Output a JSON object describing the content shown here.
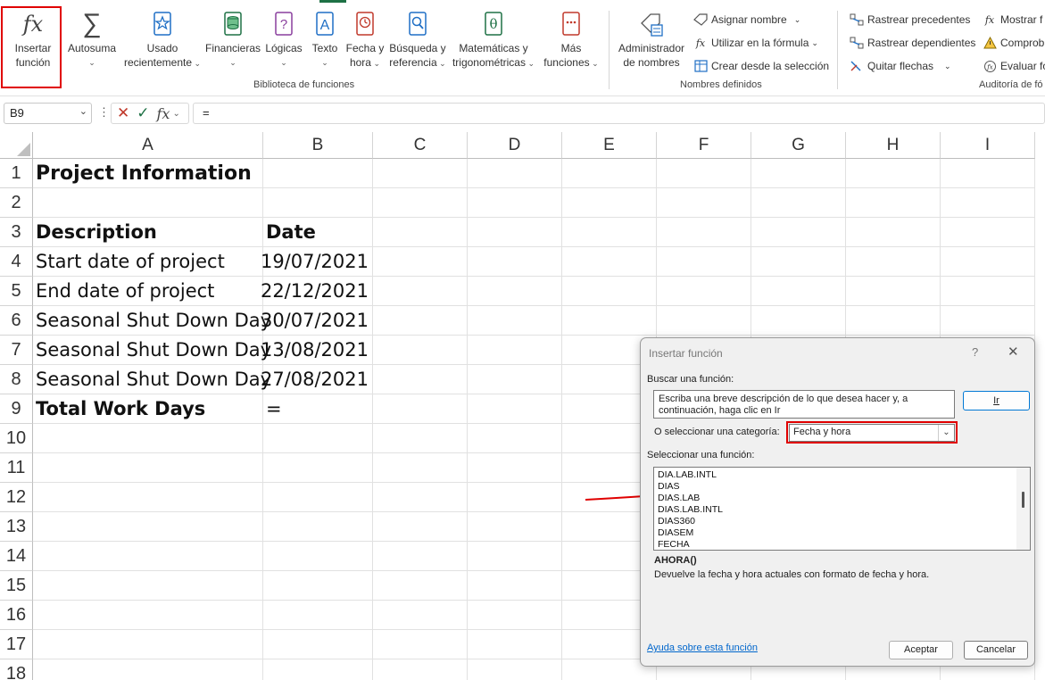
{
  "ribbon": {
    "insert_function": {
      "line1": "Insertar",
      "line2": "función"
    },
    "autosum": {
      "label": "Autosuma"
    },
    "recent": {
      "line1": "Usado",
      "line2": "recientemente"
    },
    "financial": {
      "label": "Financieras"
    },
    "logical": {
      "label": "Lógicas"
    },
    "text": {
      "label": "Texto"
    },
    "datetime": {
      "line1": "Fecha y",
      "line2": "hora"
    },
    "lookup": {
      "line1": "Búsqueda y",
      "line2": "referencia"
    },
    "math": {
      "line1": "Matemáticas y",
      "line2": "trigonométricas"
    },
    "more": {
      "line1": "Más",
      "line2": "funciones"
    },
    "library_group": "Biblioteca de funciones",
    "name_manager": {
      "line1": "Administrador",
      "line2": "de nombres"
    },
    "define_name": "Asignar nombre",
    "use_in_formula": "Utilizar en la fórmula",
    "create_from_selection": "Crear desde la selección",
    "defined_names_group": "Nombres definidos",
    "trace_precedents": "Rastrear precedentes",
    "trace_dependents": "Rastrear dependientes",
    "remove_arrows": "Quitar flechas",
    "show_formulas": "Mostrar f",
    "error_checking": "Comprob",
    "evaluate_formula": "Evaluar fó",
    "auditing_group": "Auditoría de fó"
  },
  "formula_bar": {
    "name_box": "B9",
    "formula": "="
  },
  "grid": {
    "columns": [
      "A",
      "B",
      "C",
      "D",
      "E",
      "F",
      "G",
      "H",
      "I"
    ],
    "rows": [
      "1",
      "2",
      "3",
      "4",
      "5",
      "6",
      "7",
      "8",
      "9",
      "10",
      "11",
      "12",
      "13",
      "14",
      "15",
      "16",
      "17",
      "18"
    ],
    "cells": {
      "A1": "Project Information",
      "A3": "Description",
      "B3": "Date",
      "A4": "Start date of project",
      "B4": "19/07/2021",
      "A5": "End date of project",
      "B5": "22/12/2021",
      "A6": "Seasonal Shut Down Day",
      "B6": "30/07/2021",
      "A7": "Seasonal Shut Down Day",
      "B7": "13/08/2021",
      "A8": "Seasonal Shut Down Day",
      "B8": "27/08/2021",
      "A9": "Total Work Days",
      "B9": "="
    }
  },
  "dialog": {
    "title": "Insertar función",
    "help": "?",
    "close": "✕",
    "search_label": "Buscar una función:",
    "search_text": "Escriba una breve descripción de lo que desea hacer y, a continuación, haga clic en Ir",
    "go_button": "Ir",
    "category_label": "O seleccionar una categoría:",
    "category_value": "Fecha y hora",
    "select_label": "Seleccionar una función:",
    "functions": [
      "DIA.LAB.INTL",
      "DIAS",
      "DIAS.LAB",
      "DIAS.LAB.INTL",
      "DIAS360",
      "DIASEM",
      "FECHA"
    ],
    "signature": "AHORA()",
    "description": "Devuelve la fecha y hora actuales con formato de fecha y hora.",
    "help_link": "Ayuda sobre esta función",
    "ok": "Aceptar",
    "cancel": "Cancelar"
  },
  "colors": {
    "highlight": "#e00000",
    "excel_green": "#1e7145",
    "link": "#0066cc"
  }
}
